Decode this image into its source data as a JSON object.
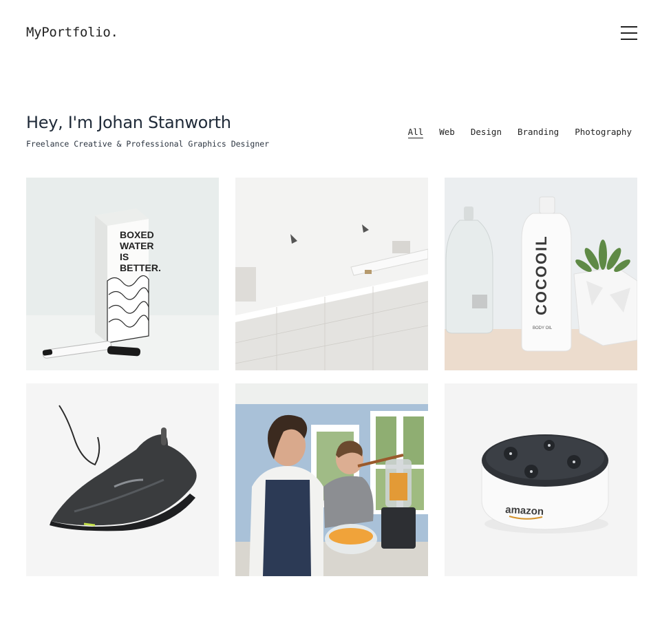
{
  "brand": {
    "logo_text": "MyPortfolio."
  },
  "menu": {
    "icon": "hamburger-menu-icon"
  },
  "hero": {
    "title": "Hey, I'm Johan Stanworth",
    "subtitle": "Freelance Creative & Professional Graphics Designer"
  },
  "filters": [
    {
      "label": "All",
      "active": true
    },
    {
      "label": "Web",
      "active": false
    },
    {
      "label": "Design",
      "active": false
    },
    {
      "label": "Branding",
      "active": false
    },
    {
      "label": "Photography",
      "active": false
    }
  ],
  "portfolio": {
    "items": [
      {
        "subject": "boxed water carton with marker",
        "carton_text": "BOXED WATER IS BETTER."
      },
      {
        "subject": "white marble staircase wall"
      },
      {
        "subject": "cocooil body oil bottle with succulent",
        "bottle_text": "COCOOIL",
        "bottle_subtext": "BODY OIL"
      },
      {
        "subject": "black running shoe"
      },
      {
        "subject": "mother and son cooking in kitchen"
      },
      {
        "subject": "amazon echo dot speaker",
        "device_text": "amazon"
      }
    ]
  },
  "colors": {
    "text": "#1f2a38",
    "background": "#ffffff"
  }
}
